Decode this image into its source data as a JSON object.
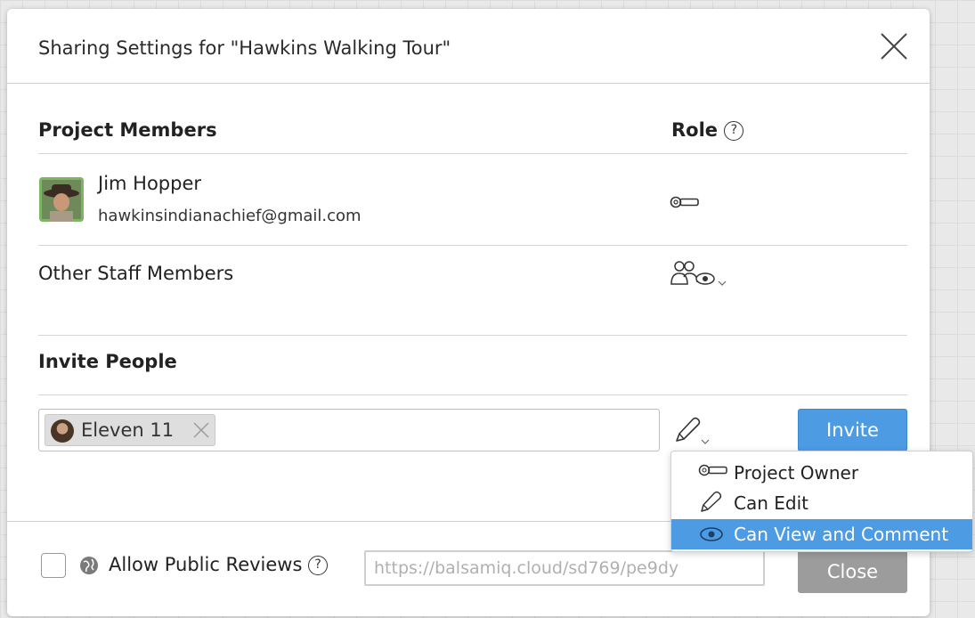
{
  "dialog": {
    "title": "Sharing Settings for \"Hawkins Walking Tour\""
  },
  "members": {
    "heading": "Project Members",
    "role_heading": "Role",
    "list": [
      {
        "name": "Jim Hopper",
        "email": "hawkinsindianachief@gmail.com",
        "role_icon": "key-icon"
      }
    ],
    "other": {
      "label": "Other Staff Members",
      "role_icon": "group-view-icon"
    }
  },
  "invite": {
    "heading": "Invite People",
    "chip_label": "Eleven 11",
    "role_icon": "pencil-icon",
    "button_label": "Invite"
  },
  "role_menu": {
    "items": [
      {
        "label": "Project Owner",
        "icon": "key-icon"
      },
      {
        "label": "Can Edit",
        "icon": "pencil-icon"
      },
      {
        "label": "Can View and Comment",
        "icon": "eye-icon",
        "selected": true
      }
    ]
  },
  "footer": {
    "public_label": "Allow Public Reviews",
    "public_checked": false,
    "url_value": "https://balsamiq.cloud/sd769/pe9dy",
    "close_label": "Close"
  },
  "colors": {
    "accent": "#4d9be3",
    "close_button": "#9c9c9c"
  }
}
